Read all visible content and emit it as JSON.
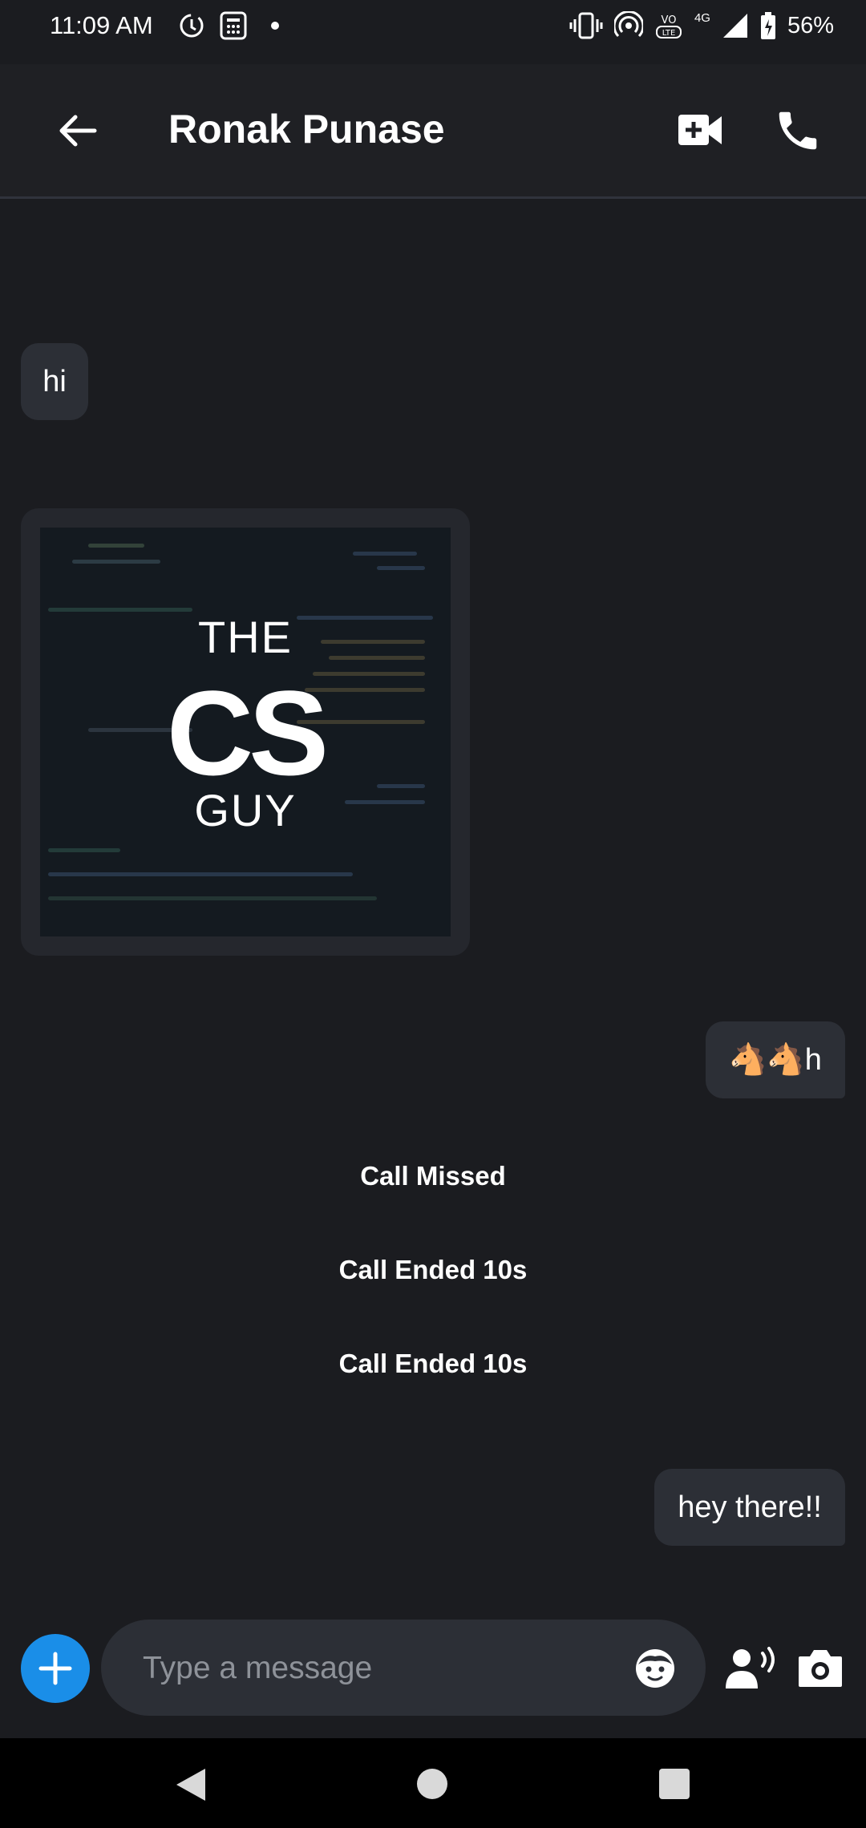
{
  "status_bar": {
    "time": "11:09 AM",
    "battery": "56%",
    "network": "4G",
    "left_icons": [
      "sync-icon",
      "calculator-icon",
      "dot-icon"
    ],
    "right_icons": [
      "vibrate-icon",
      "hotspot-icon",
      "volte-icon",
      "signal-icon",
      "battery-icon"
    ]
  },
  "header": {
    "title": "Ronak Punase",
    "actions": [
      "back-arrow-icon",
      "video-call-icon",
      "phone-call-icon"
    ]
  },
  "messages": [
    {
      "type": "incoming_text",
      "text": "hi"
    },
    {
      "type": "incoming_image",
      "logo_line1": "THE",
      "logo_line2": "CS",
      "logo_line3": "GUY"
    },
    {
      "type": "outgoing_text",
      "text": "🐴🐴h"
    },
    {
      "type": "system",
      "text": "Call Missed"
    },
    {
      "type": "system",
      "text": "Call Ended 10s"
    },
    {
      "type": "system",
      "text": "Call Ended 10s"
    },
    {
      "type": "outgoing_text",
      "text": "hey there!!"
    }
  ],
  "composer": {
    "placeholder": "Type a message",
    "value": "",
    "accent_color": "#1a8ee8"
  },
  "colors": {
    "background": "#1b1c20",
    "bubble": "#2c2f36",
    "header": "#1f2024"
  }
}
